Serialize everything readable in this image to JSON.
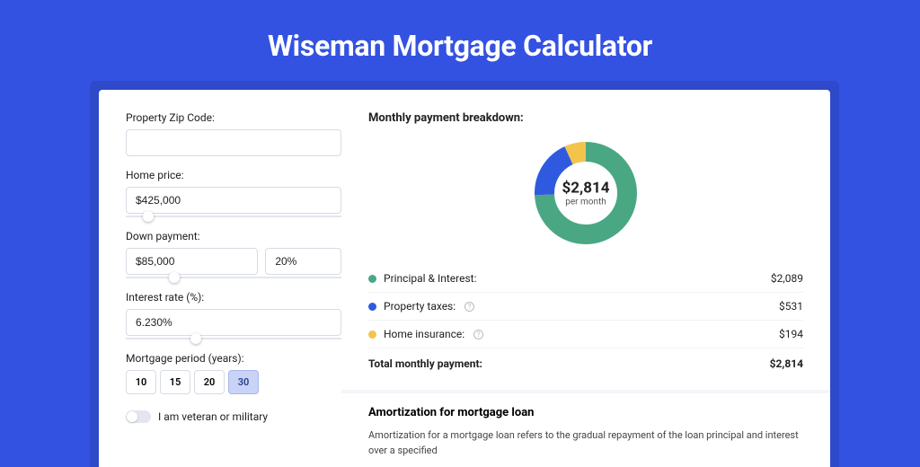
{
  "header": {
    "title": "Wiseman Mortgage Calculator"
  },
  "form": {
    "zip": {
      "label": "Property Zip Code:",
      "value": ""
    },
    "home_price": {
      "label": "Home price:",
      "value": "$425,000",
      "slider_pct": 8
    },
    "down_payment": {
      "label": "Down payment:",
      "amount": "$85,000",
      "percent": "20%",
      "slider_pct": 20
    },
    "interest": {
      "label": "Interest rate (%):",
      "value": "6.230%",
      "slider_pct": 30
    },
    "period": {
      "label": "Mortgage period (years):",
      "options": [
        "10",
        "15",
        "20",
        "30"
      ],
      "selected": "30"
    },
    "veteran": {
      "label": "I am veteran or military"
    }
  },
  "breakdown": {
    "title": "Monthly payment breakdown:",
    "total_amount": "$2,814",
    "per_month": "per month",
    "items": [
      {
        "label": "Principal & Interest:",
        "value": "$2,089",
        "color": "#4aa784",
        "info": false
      },
      {
        "label": "Property taxes:",
        "value": "$531",
        "color": "#2f5ae0",
        "info": true
      },
      {
        "label": "Home insurance:",
        "value": "$194",
        "color": "#f3c44b",
        "info": true
      }
    ],
    "total_label": "Total monthly payment:",
    "total_value": "$2,814"
  },
  "amort": {
    "title": "Amortization for mortgage loan",
    "text": "Amortization for a mortgage loan refers to the gradual repayment of the loan principal and interest over a specified"
  },
  "chart_data": {
    "type": "pie",
    "title": "Monthly payment breakdown",
    "series": [
      {
        "name": "Principal & Interest",
        "value": 2089,
        "color": "#4aa784"
      },
      {
        "name": "Property taxes",
        "value": 531,
        "color": "#2f5ae0"
      },
      {
        "name": "Home insurance",
        "value": 194,
        "color": "#f3c44b"
      }
    ],
    "total": 2814,
    "center_label": "$2,814 per month"
  }
}
